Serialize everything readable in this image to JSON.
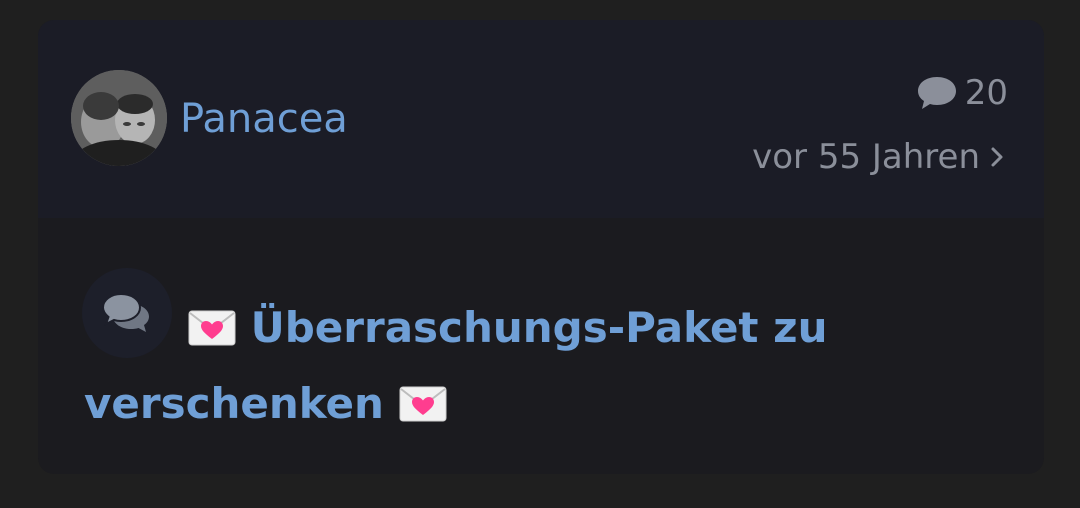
{
  "post": {
    "author": "Panacea",
    "reply_count": "20",
    "time_ago": "vor 55 Jahren",
    "title_part1": "Überraschungs-Paket zu verschenken",
    "title_emoji_name": "love-letter-icon"
  },
  "colors": {
    "background": "#1f1f1f",
    "card": "#1b1b1f",
    "header": "#1b1c26",
    "accent": "#6f9fd6",
    "muted": "#8b8f9a"
  }
}
